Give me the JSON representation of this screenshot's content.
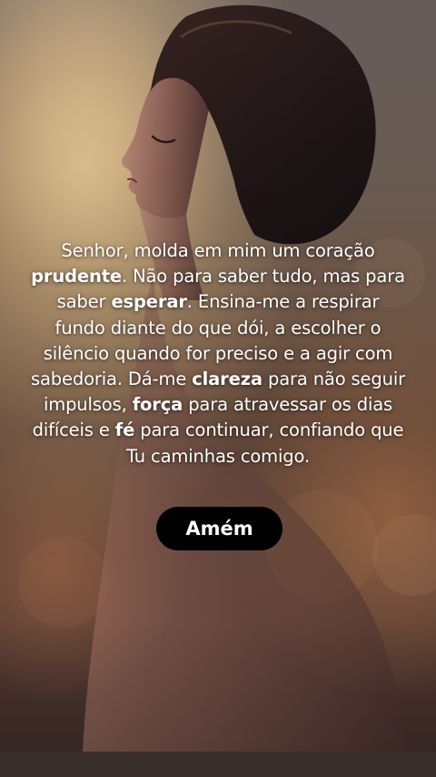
{
  "prayer": {
    "t1": "Senhor, molda em mim um coração ",
    "b1": "prudente",
    "t2": ". Não para saber tudo, mas para saber ",
    "b2": "esperar",
    "t3": ". Ensina-me a respirar fundo diante do que dói, a escolher o silêncio quando for preciso e a agir com sabedoria. Dá-me ",
    "b3": "clareza",
    "t4": " para não seguir impulsos, ",
    "b4": "força",
    "t5": " para atravessar os dias difíceis e ",
    "b5": "fé",
    "t6": " para continuar, confiando que Tu caminhas comigo."
  },
  "amen_button": {
    "label": "Amém"
  },
  "colors": {
    "text": "#ffffff",
    "button_bg": "#000000",
    "button_text": "#ffffff",
    "warm_glow": "#f5c98a",
    "silhouette": "#2b1f1f"
  }
}
